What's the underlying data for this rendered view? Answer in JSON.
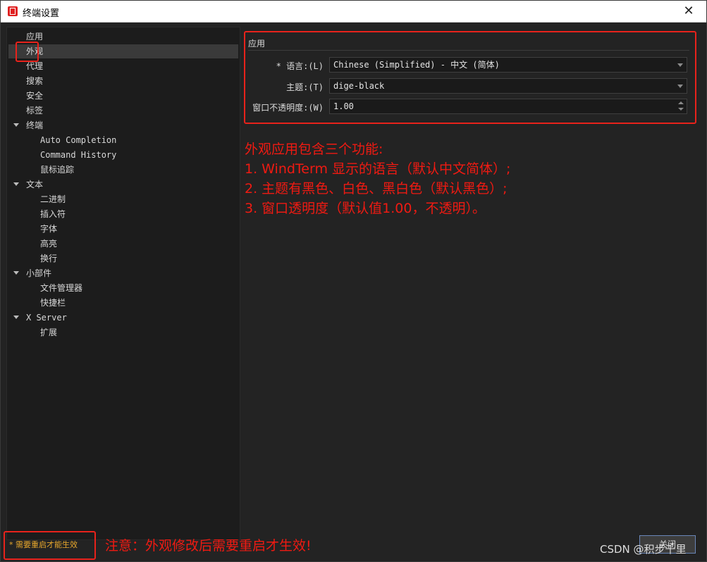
{
  "window": {
    "title": "终端设置",
    "close_glyph": "✕"
  },
  "sidebar": {
    "items": [
      {
        "label": "应用"
      },
      {
        "label": "外观"
      },
      {
        "label": "代理"
      },
      {
        "label": "搜索"
      },
      {
        "label": "安全"
      },
      {
        "label": "标签"
      },
      {
        "label": "终端"
      },
      {
        "label": "Auto Completion"
      },
      {
        "label": "Command History"
      },
      {
        "label": "鼠标追踪"
      },
      {
        "label": "文本"
      },
      {
        "label": "二进制"
      },
      {
        "label": "插入符"
      },
      {
        "label": "字体"
      },
      {
        "label": "高亮"
      },
      {
        "label": "换行"
      },
      {
        "label": "小部件"
      },
      {
        "label": "文件管理器"
      },
      {
        "label": "快捷栏"
      },
      {
        "label": "X Server"
      },
      {
        "label": "扩展"
      }
    ],
    "selected": "外观"
  },
  "panel": {
    "title": "应用",
    "language": {
      "label": "* 语言:(L)",
      "value": "Chinese (Simplified) - 中文 (简体)"
    },
    "theme": {
      "label": "主题:(T)",
      "value": "dige-black"
    },
    "opacity": {
      "label": "窗口不透明度:(W)",
      "value": "1.00"
    }
  },
  "annotation": {
    "lines": [
      "外观应用包含三个功能:",
      "1. WindTerm 显示的语言（默认中文简体）;",
      "2. 主题有黑色、白色、黑白色（默认黑色）;",
      "3. 窗口透明度（默认值1.00，不透明）。"
    ]
  },
  "footer": {
    "restart_note": "* 需要重启才能生效",
    "annotation": "注意：外观修改后需要重启才生效!",
    "close_button": "关闭",
    "watermark": "CSDN @积步千里"
  },
  "colors": {
    "highlight_red": "#e8221b",
    "annotation_red": "#f01a12",
    "note_orange": "#e8a82c",
    "background": "#232323"
  }
}
